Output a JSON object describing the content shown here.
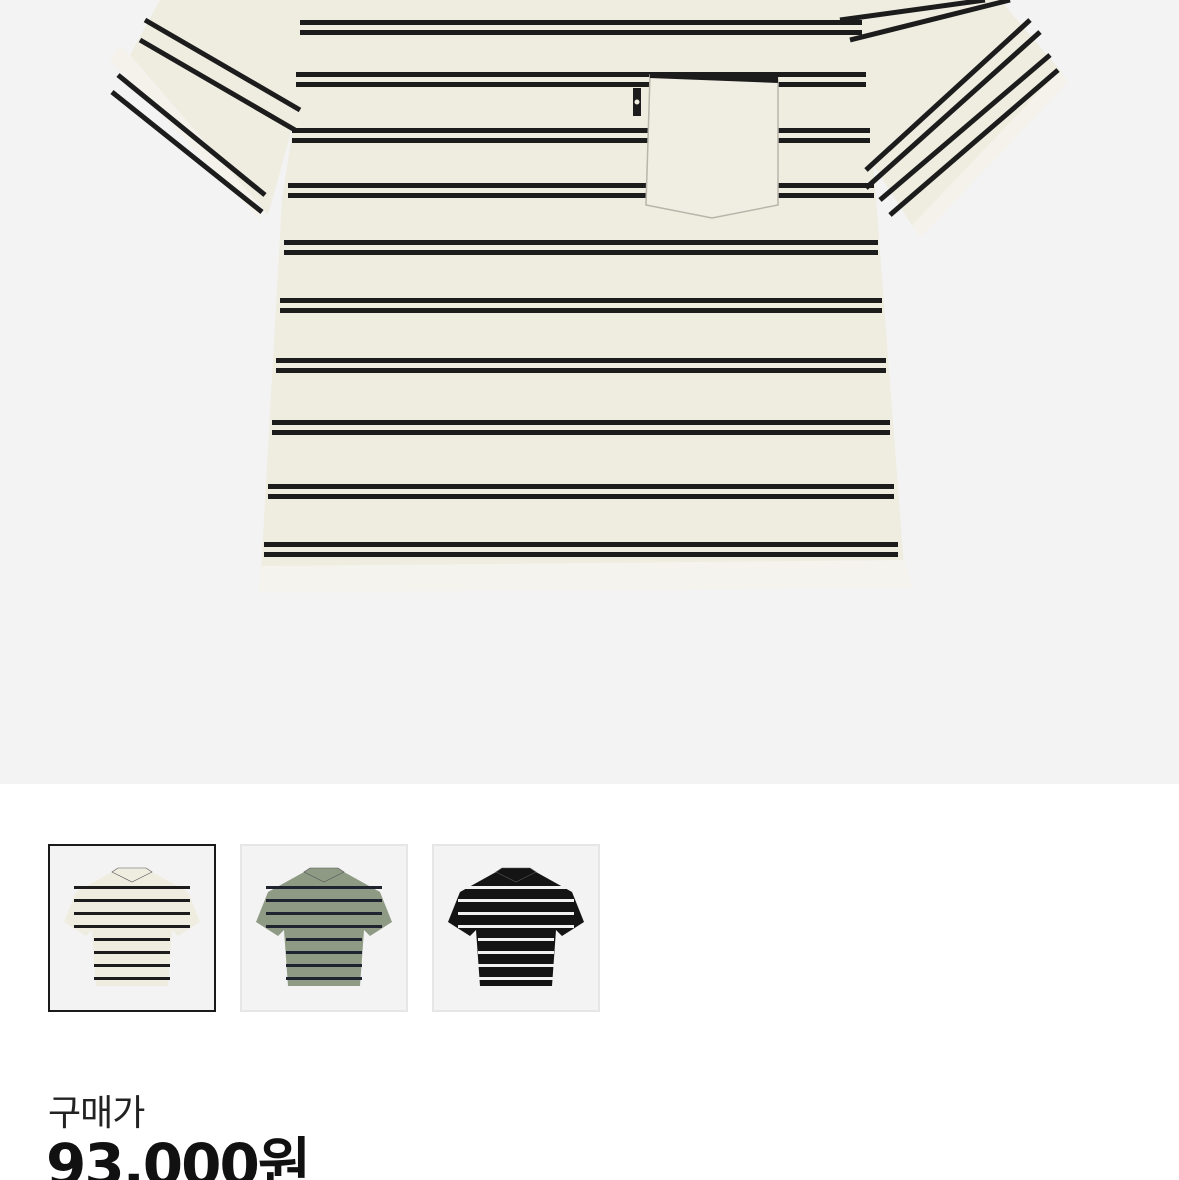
{
  "product": {
    "main_image": "striped-polo-shirt-ivory",
    "thumbnails": [
      {
        "name": "ivory-black-stripe",
        "selected": true,
        "body_color": "#efece0",
        "stripe_color": "#1c1c1c"
      },
      {
        "name": "olive-navy-stripe",
        "selected": false,
        "body_color": "#8f9a85",
        "stripe_color": "#1f2430"
      },
      {
        "name": "black-white-stripe",
        "selected": false,
        "body_color": "#141414",
        "stripe_color": "#f2f2f2"
      }
    ]
  },
  "pricing": {
    "label": "구매가",
    "price": "93,000원"
  },
  "colors": {
    "hero_background": "#f3f3f3",
    "shirt_body": "#efece0",
    "stripe": "#1c1c1c",
    "selected_border": "#1a1a1a",
    "thumb_border": "#e6e6e6"
  }
}
